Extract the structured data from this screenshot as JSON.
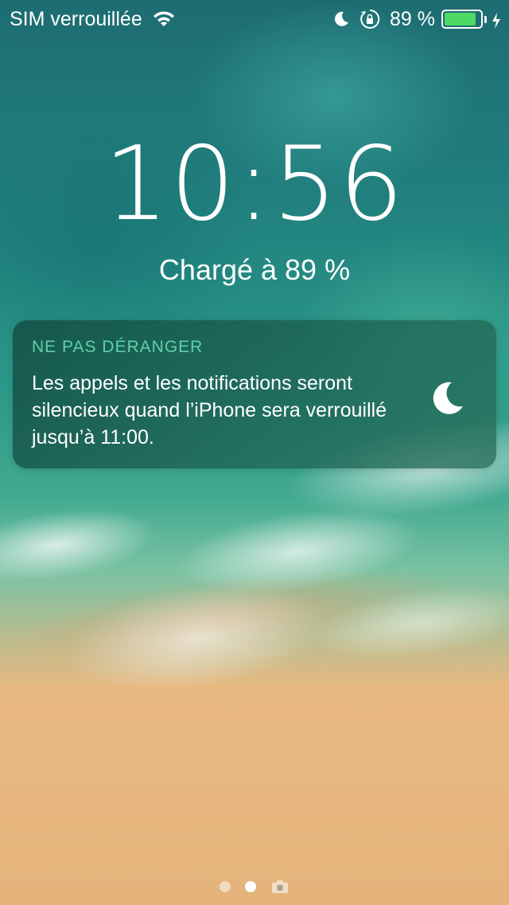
{
  "status_bar": {
    "carrier": "SIM verrouillée",
    "battery_percent_text": "89 %",
    "battery_level": 0.89,
    "icons": [
      "wifi-icon",
      "moon-icon",
      "rotation-lock-icon",
      "battery-icon",
      "charging-bolt-icon"
    ],
    "battery_color": "#4cd964"
  },
  "lock_screen": {
    "time": "10:56",
    "charge_status": "Chargé à 89 %"
  },
  "dnd_notification": {
    "title": "NE PAS DÉRANGER",
    "body": "Les appels et les notifications seront silencieux quand l’iPhone sera verrouillé jusqu’à 11:00.",
    "icon": "moon-icon",
    "title_color": "#5fd0a8"
  },
  "page_indicator": {
    "pages": 2,
    "active_index": 1,
    "trailing_icon": "camera-icon"
  }
}
